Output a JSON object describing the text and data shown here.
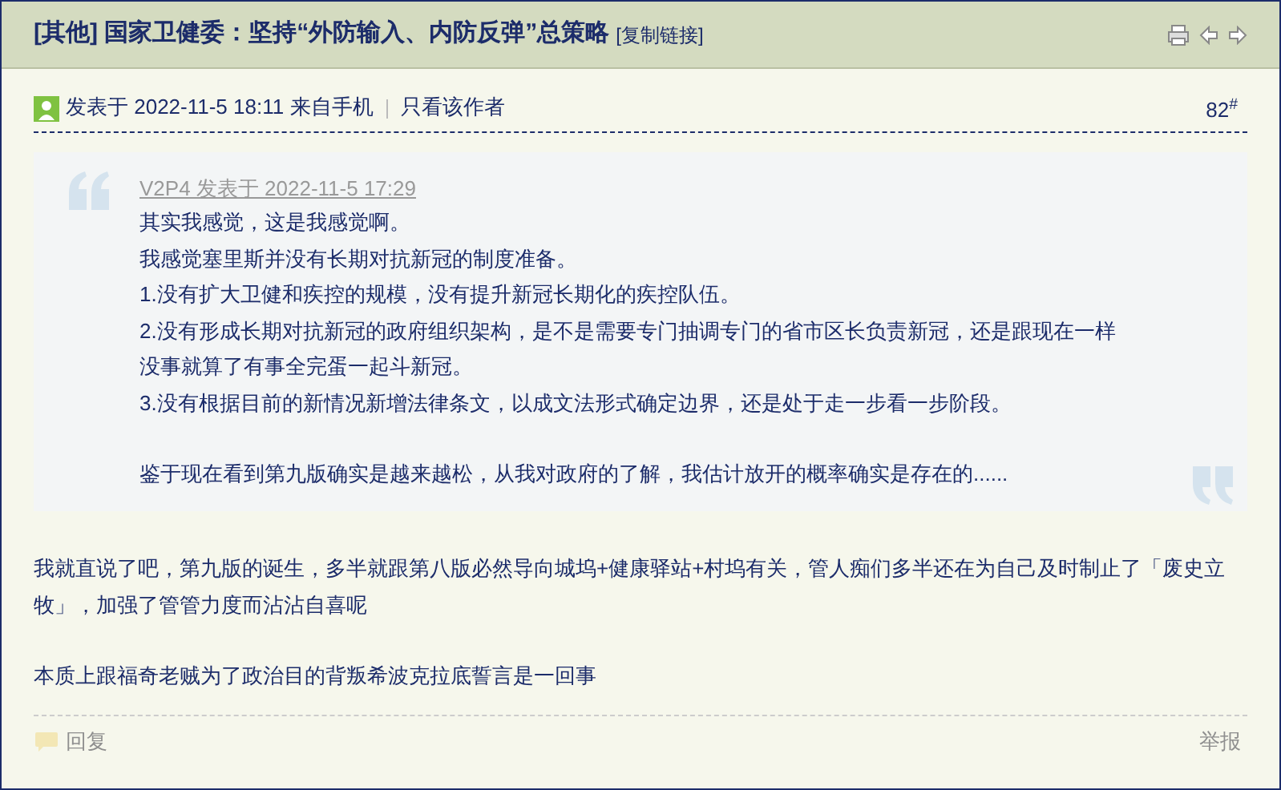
{
  "title": "[其他] 国家卫健委：坚持“外防输入、内防反弹”总策略",
  "copy_link": "[复制链接]",
  "meta": {
    "posted": "发表于 2022-11-5 18:11",
    "source": "来自手机",
    "author_only": "只看该作者",
    "floor": "82",
    "floor_mark": "#"
  },
  "quote": {
    "author_line": "V2P4 发表于 2022-11-5 17:29",
    "paragraphs": [
      [
        "其实我感觉，这是我感觉啊。",
        "我感觉塞里斯并没有长期对抗新冠的制度准备。",
        "1.没有扩大卫健和疾控的规模，没有提升新冠长期化的疾控队伍。",
        "2.没有形成长期对抗新冠的政府组织架构，是不是需要专门抽调专门的省市区长负责新冠，还是跟现在一样没事就算了有事全完蛋一起斗新冠。",
        "3.没有根据目前的新情况新增法律条文，以成文法形式确定边界，还是处于走一步看一步阶段。"
      ],
      [
        "鉴于现在看到第九版确实是越来越松，从我对政府的了解，我估计放开的概率确实是存在的......"
      ]
    ]
  },
  "body": [
    "我就直说了吧，第九版的诞生，多半就跟第八版必然导向城坞+健康驿站+村坞有关，管人痴们多半还在为自己及时制止了「废史立牧」，加强了管管力度而沾沾自喜呢",
    "本质上跟福奇老贼为了政治目的背叛希波克拉底誓言是一回事"
  ],
  "footer": {
    "reply": "回复",
    "report": "举报"
  }
}
